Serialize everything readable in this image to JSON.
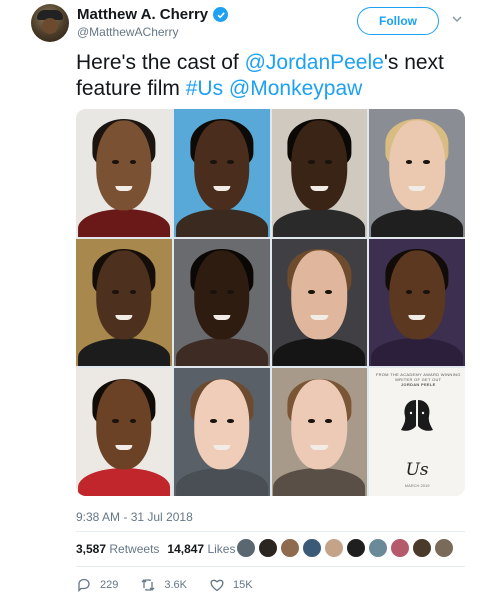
{
  "header": {
    "display_name": "Matthew A. Cherry",
    "handle": "@MatthewACherry",
    "follow_label": "Follow"
  },
  "tweet": {
    "text_part1": "Here's the cast of ",
    "mention1": "@JordanPeele",
    "text_part2": "'s next feature film ",
    "hashtag": "#Us",
    "text_part3": " ",
    "mention2": "@Monkeypaw"
  },
  "photos": [
    {
      "bg": "#e9e7e3",
      "skin": "#7a5233",
      "hair": "#1b1410",
      "shirt": "#6a1818"
    },
    {
      "bg": "#58a9d8",
      "skin": "#4a2d1c",
      "hair": "#0e0a08",
      "shirt": "#3b2a20"
    },
    {
      "bg": "#cfc9bf",
      "skin": "#3a2416",
      "hair": "#0c0806",
      "shirt": "#2a2a2a"
    },
    {
      "bg": "#8a8e94",
      "skin": "#eac9b0",
      "hair": "#d9bc82",
      "shirt": "#1f1f1f"
    },
    {
      "bg": "#a8884c",
      "skin": "#4d301d",
      "hair": "#140d08",
      "shirt": "#1c1c1c"
    },
    {
      "bg": "#6a6b6f",
      "skin": "#2f1c10",
      "hair": "#0b0705",
      "shirt": "#3d2b24"
    },
    {
      "bg": "#3f3f44",
      "skin": "#e0b79c",
      "hair": "#6e4b2c",
      "shirt": "#151515"
    },
    {
      "bg": "#3c2f4f",
      "skin": "#5c3821",
      "hair": "#120c08",
      "shirt": "#2c1f3c"
    },
    {
      "bg": "#ece9e4",
      "skin": "#6b4226",
      "hair": "#120c08",
      "shirt": "#c0262b"
    },
    {
      "bg": "#596068",
      "skin": "#efcdb8",
      "hair": "#6b4a30",
      "shirt": "#4a4f55"
    },
    {
      "bg": "#a89a8a",
      "skin": "#eccab5",
      "hair": "#7a5536",
      "shirt": "#5a4f46"
    }
  ],
  "poster": {
    "tagline": "FROM THE ACADEMY AWARD WINNING WRITER OF GET OUT",
    "director": "JORDAN PEELE",
    "title": "Us",
    "footer": "MARCH 2019"
  },
  "meta": {
    "timestamp": "9:38 AM - 31 Jul 2018",
    "retweets_count": "3,587",
    "retweets_label": "Retweets",
    "likes_count": "14,847",
    "likes_label": "Likes"
  },
  "likers": [
    "#5b6770",
    "#2c2622",
    "#8e6a4f",
    "#3b5a78",
    "#c4a388",
    "#1f1f1f",
    "#6a8a9a",
    "#b45a6a",
    "#4a3a2a",
    "#7a6a5a"
  ],
  "actions": {
    "replies": "229",
    "retweets": "3.6K",
    "likes": "15K"
  },
  "colors": {
    "accent": "#1da1f2",
    "muted": "#657786",
    "text": "#14171a"
  }
}
